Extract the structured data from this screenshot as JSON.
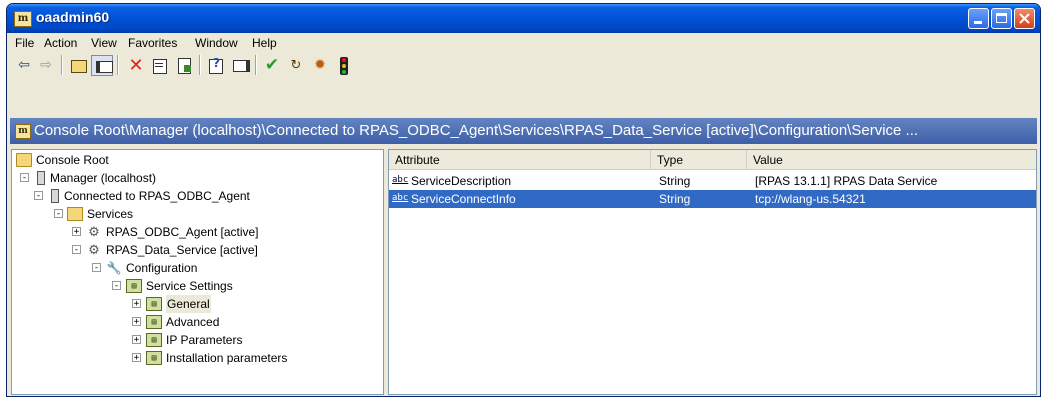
{
  "window": {
    "title": "oaadmin60",
    "icon": "mmc-console-icon"
  },
  "menu": [
    {
      "key": "file",
      "label": "File"
    },
    {
      "key": "action",
      "label": "Action"
    },
    {
      "key": "view",
      "label": "View"
    },
    {
      "key": "favorites",
      "label": "Favorites"
    },
    {
      "key": "window",
      "label": "Window"
    },
    {
      "key": "help",
      "label": "Help"
    }
  ],
  "toolbar": {
    "icons": [
      "back-arrow-icon",
      "forward-arrow-icon",
      "up-folder-icon",
      "show-hide-tree-icon",
      "delete-icon",
      "properties-icon",
      "export-list-icon",
      "help-icon",
      "show-hide-action-pane-icon",
      "checkmark-icon",
      "refresh-icon",
      "start-service-icon",
      "traffic-light-icon"
    ]
  },
  "path": {
    "text": "Console Root\\Manager (localhost)\\Connected to RPAS_ODBC_Agent\\Services\\RPAS_Data_Service [active]\\Configuration\\Service ..."
  },
  "tree": {
    "nodes": [
      {
        "label": "Console Root",
        "icon": "folder-icon",
        "level": 0,
        "expander": ""
      },
      {
        "label": "Manager (localhost)",
        "icon": "server-icon",
        "level": 1,
        "expander": "-"
      },
      {
        "label": "Connected to RPAS_ODBC_Agent",
        "icon": "server-icon",
        "level": 2,
        "expander": "-"
      },
      {
        "label": "Services",
        "icon": "folder-open-icon",
        "level": 3,
        "expander": "-"
      },
      {
        "label": "RPAS_ODBC_Agent [active]",
        "icon": "service-gears-icon",
        "level": 4,
        "expander": "+"
      },
      {
        "label": "RPAS_Data_Service [active]",
        "icon": "service-gears-icon",
        "level": 4,
        "expander": "-"
      },
      {
        "label": "Configuration",
        "icon": "wrench-icon",
        "level": 5,
        "expander": "-"
      },
      {
        "label": "Service Settings",
        "icon": "settings-icon",
        "level": 6,
        "expander": "-"
      },
      {
        "label": "General",
        "icon": "settings-icon",
        "level": 7,
        "expander": "+"
      },
      {
        "label": "Advanced",
        "icon": "settings-icon",
        "level": 7,
        "expander": "+"
      },
      {
        "label": "IP Parameters",
        "icon": "settings-icon",
        "level": 7,
        "expander": "+"
      },
      {
        "label": "Installation parameters",
        "icon": "settings-icon",
        "level": 7,
        "expander": "+"
      }
    ]
  },
  "list": {
    "columns": [
      "Attribute",
      "Type",
      "Value"
    ],
    "rows": [
      {
        "attribute": "ServiceDescription",
        "type": "String",
        "value": "[RPAS 13.1.1] RPAS Data Service",
        "icon_text": "abc",
        "selected": false
      },
      {
        "attribute": "ServiceConnectInfo",
        "type": "String",
        "value": "tcp://wlang-us.54321",
        "icon_text": "abc",
        "selected": true
      }
    ]
  },
  "colors": {
    "title_blue": "#0051d8",
    "selection_blue": "#316ac5",
    "path_bar": "#4a6db4"
  }
}
